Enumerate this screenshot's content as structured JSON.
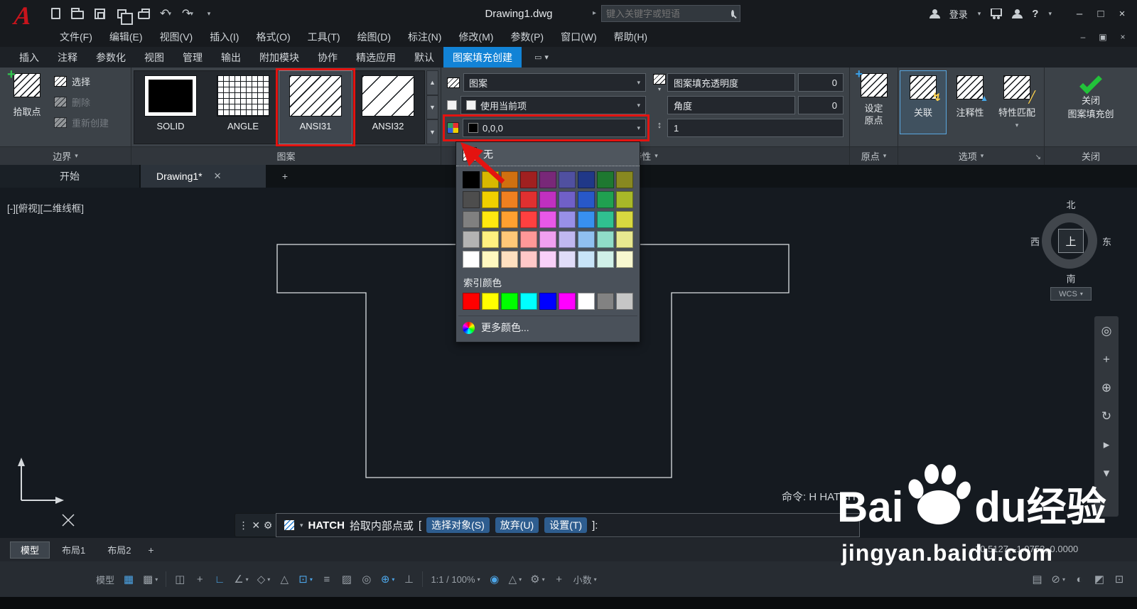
{
  "title_bar": {
    "title": "Drawing1.dwg",
    "search_placeholder": "键入关键字或短语",
    "login_label": "登录",
    "quick_access": [
      "new-file",
      "open-file",
      "save",
      "save-as",
      "plot",
      "publish",
      "undo",
      "redo",
      "customize"
    ]
  },
  "menu_bar": {
    "items": [
      "文件(F)",
      "编辑(E)",
      "视图(V)",
      "插入(I)",
      "格式(O)",
      "工具(T)",
      "绘图(D)",
      "标注(N)",
      "修改(M)",
      "参数(P)",
      "窗口(W)",
      "帮助(H)"
    ]
  },
  "ribbon": {
    "tabs": [
      {
        "label": "插入",
        "active": false
      },
      {
        "label": "注释",
        "active": false
      },
      {
        "label": "参数化",
        "active": false
      },
      {
        "label": "视图",
        "active": false
      },
      {
        "label": "管理",
        "active": false
      },
      {
        "label": "输出",
        "active": false
      },
      {
        "label": "附加模块",
        "active": false
      },
      {
        "label": "协作",
        "active": false
      },
      {
        "label": "精选应用",
        "active": false
      },
      {
        "label": "默认",
        "active": false
      },
      {
        "label": "图案填充创建",
        "active": true
      }
    ],
    "boundaries": {
      "pick_points": "拾取点",
      "select": "选择",
      "remove": "删除",
      "recreate": "重新创建",
      "panel_label": "边界"
    },
    "pattern": {
      "panel_label": "图案",
      "items": [
        {
          "name": "SOLID",
          "selected": false
        },
        {
          "name": "ANGLE",
          "selected": false
        },
        {
          "name": "ANSI31",
          "selected": true
        },
        {
          "name": "ANSI32",
          "selected": false
        }
      ]
    },
    "properties": {
      "panel_label": "特性",
      "pattern_type": "图案",
      "color_mode": "使用当前项",
      "color_value": "0,0,0",
      "transparency_label": "图案填充透明度",
      "transparency_value": "0",
      "angle_label": "角度",
      "angle_value": "0",
      "scale_value": "1"
    },
    "origin": {
      "button_line1": "设定",
      "button_line2": "原点",
      "panel_label": "原点"
    },
    "options": {
      "associative": "关联",
      "annotative": "注释性",
      "match_properties": "特性匹配",
      "panel_label": "选项"
    },
    "close": {
      "line1": "关闭",
      "line2": "图案填充创",
      "panel_label": "关闭"
    }
  },
  "color_dropdown": {
    "none_label": "无",
    "index_label": "索引颜色",
    "more_label": "更多颜色...",
    "palette": [
      [
        "#000000",
        "#d8b800",
        "#d07010",
        "#a02020",
        "#782878",
        "#5050a0",
        "#203888",
        "#1e7830",
        "#888820"
      ],
      [
        "#4d4d4d",
        "#f0d000",
        "#f08020",
        "#e03030",
        "#c030c0",
        "#7060c8",
        "#2858c8",
        "#20a050",
        "#a8b828"
      ],
      [
        "#808080",
        "#ffe810",
        "#ffa030",
        "#ff4040",
        "#e858e8",
        "#9890e8",
        "#3890f0",
        "#30c090",
        "#d8d840"
      ],
      [
        "#b3b3b3",
        "#fff080",
        "#ffc878",
        "#ff9898",
        "#f0a0f0",
        "#c0b8f0",
        "#90c0f0",
        "#90dcc8",
        "#e8e890"
      ],
      [
        "#ffffff",
        "#fff8c0",
        "#ffe0c0",
        "#ffc8c8",
        "#f8d0f8",
        "#e0dcf8",
        "#c8e4f8",
        "#d0f0e8",
        "#f8f8d0"
      ]
    ],
    "index_colors": [
      "#ff0000",
      "#ffff00",
      "#00ff00",
      "#00ffff",
      "#0000ff",
      "#ff00ff",
      "#ffffff",
      "#828282",
      "#c6c6c6"
    ]
  },
  "doc_tabs": {
    "start": "开始",
    "active": "Drawing1*"
  },
  "canvas": {
    "viewport_label": "[-][俯视][二维线框]",
    "command_echo": "命令: H HATCH",
    "viewcube": {
      "n": "北",
      "s": "南",
      "w": "西",
      "e": "东",
      "center": "上",
      "wcs": "WCS"
    }
  },
  "nav_bar": {
    "icons": [
      {
        "name": "full-navigation-wheel-icon",
        "glyph": "◎"
      },
      {
        "name": "pan-icon",
        "glyph": "+"
      },
      {
        "name": "zoom-icon",
        "glyph": "⊕"
      },
      {
        "name": "orbit-icon",
        "glyph": "↻"
      },
      {
        "name": "show-motion-icon",
        "glyph": "▸"
      },
      {
        "name": "nav-more-icon",
        "glyph": "▾"
      }
    ]
  },
  "command_line": {
    "command": "HATCH",
    "prompt": "拾取内部点或",
    "bracket_open": "[",
    "bracket_close": "]:",
    "options": [
      "选择对象(S)",
      "放弃(U)",
      "设置(T)"
    ]
  },
  "layout_bar": {
    "tabs": [
      {
        "label": "模型",
        "active": true
      },
      {
        "label": "布局1",
        "active": false
      },
      {
        "label": "布局2",
        "active": false
      }
    ],
    "coords": "10.5127, -1.0753, 0.0000"
  },
  "status_bar": {
    "items": [
      {
        "name": "model-space-toggle",
        "text": "模型"
      },
      {
        "name": "grid-display-icon",
        "glyph": "▦",
        "active": true
      },
      {
        "name": "snap-mode-icon",
        "glyph": "▩",
        "caret": true
      },
      {
        "name": "separator",
        "sep": true
      },
      {
        "name": "infer-constraints-icon",
        "glyph": "◫"
      },
      {
        "name": "dynamic-input-icon",
        "glyph": "+"
      },
      {
        "name": "ortho-mode-icon",
        "glyph": "∟",
        "active": true
      },
      {
        "name": "polar-tracking-icon",
        "glyph": "∠",
        "caret": true
      },
      {
        "name": "isometric-drafting-icon",
        "glyph": "◇",
        "caret": true
      },
      {
        "name": "object-snap-tracking-icon",
        "glyph": "△"
      },
      {
        "name": "object-snap-icon",
        "glyph": "⊡",
        "active": true,
        "caret": true
      },
      {
        "name": "lineweight-icon",
        "glyph": "≡"
      },
      {
        "name": "transparency-icon",
        "glyph": "▨"
      },
      {
        "name": "selection-cycling-icon",
        "glyph": "◎"
      },
      {
        "name": "object-snap-3d-icon",
        "glyph": "⊕",
        "active": true,
        "caret": true
      },
      {
        "name": "dynamic-ucs-icon",
        "glyph": "⊥"
      },
      {
        "name": "separator",
        "sep": true
      },
      {
        "name": "annotation-scale",
        "text": "1:1 / 100%",
        "caret": true
      },
      {
        "name": "annotation-visibility-icon",
        "glyph": "◉",
        "active": true
      },
      {
        "name": "auto-annotation-scale-icon",
        "glyph": "△",
        "caret": true
      },
      {
        "name": "workspace-switching-icon",
        "glyph": "⚙",
        "caret": true
      },
      {
        "name": "annotation-monitor-icon",
        "glyph": "+"
      },
      {
        "name": "units",
        "text": "小数",
        "caret": true
      },
      {
        "name": "spacer",
        "spacer": true
      },
      {
        "name": "quick-properties-icon",
        "glyph": "▤"
      },
      {
        "name": "lock-ui-icon",
        "glyph": "⊘",
        "caret": true
      },
      {
        "name": "isolate-objects-icon",
        "glyph": "◐"
      },
      {
        "name": "graphics-performance-icon",
        "glyph": "◩"
      },
      {
        "name": "clean-screen-icon",
        "glyph": "⊡"
      }
    ]
  },
  "watermark": {
    "bai": "Bai",
    "du": "du",
    "brand": "经验",
    "url": "jingyan.baidu.com"
  }
}
